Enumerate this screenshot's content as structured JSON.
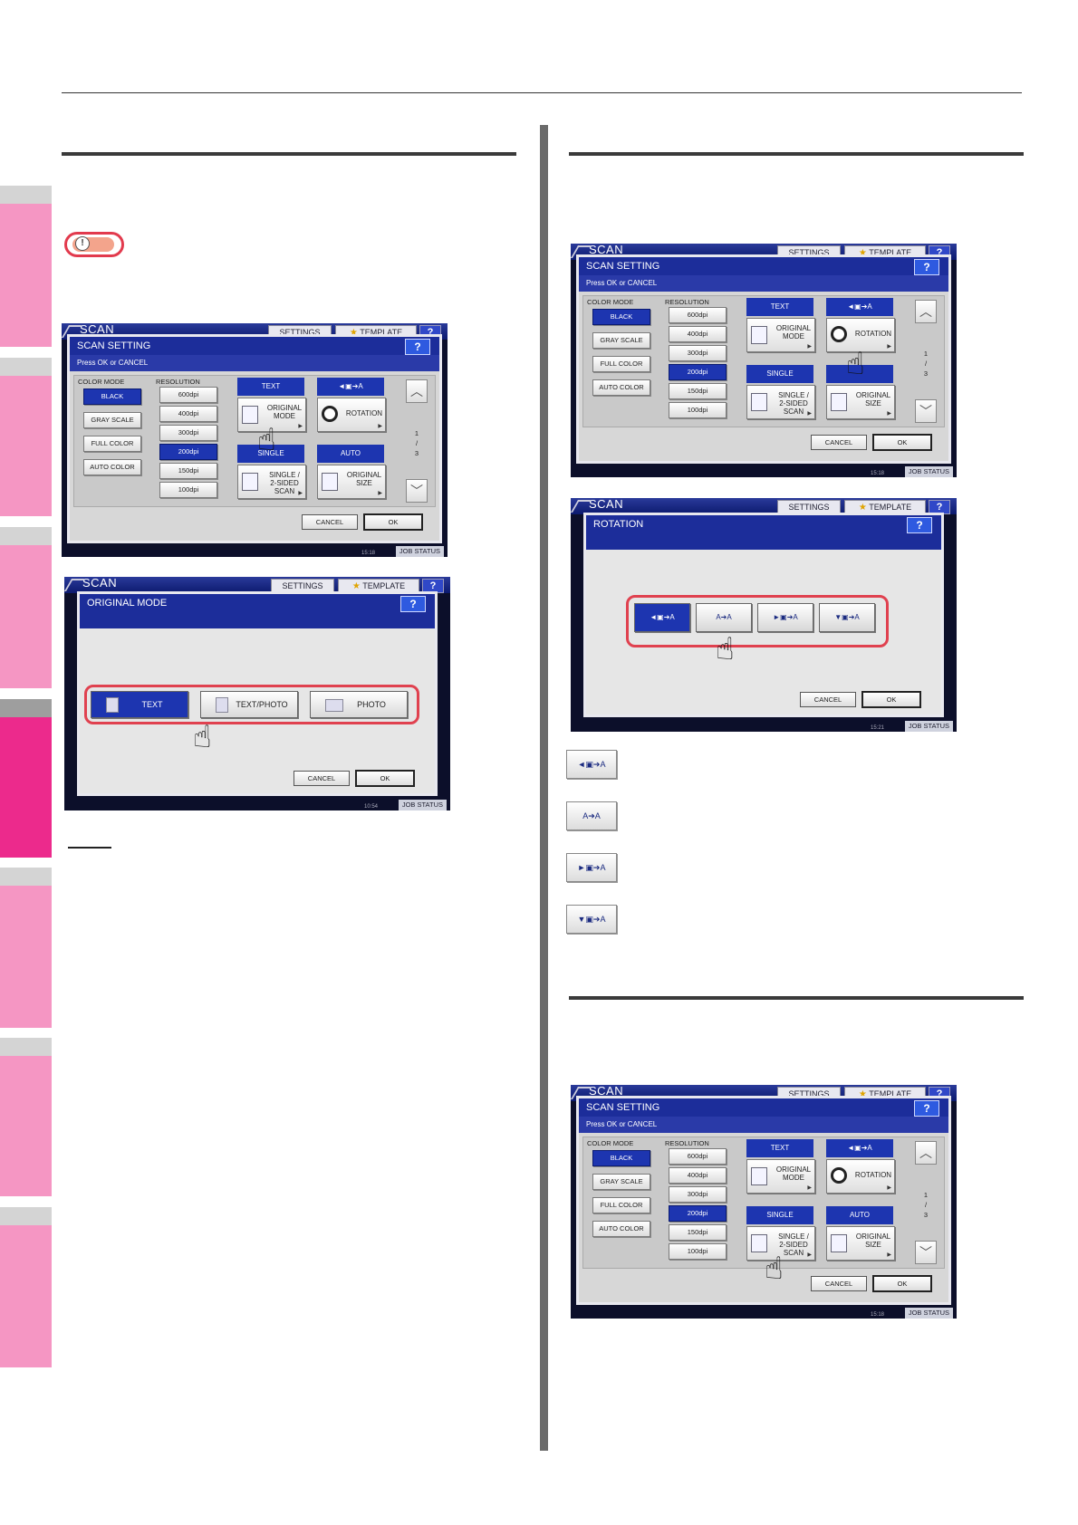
{
  "note_icon": "warning-note-icon",
  "shared": {
    "scan": "SCAN",
    "settings": "SETTINGS",
    "template": "TEMPLATE",
    "help": "?",
    "scan_setting": "SCAN SETTING",
    "press_ok": "Press OK or CANCEL",
    "color_mode": "COLOR MODE",
    "resolution": "RESOLUTION",
    "black": "BLACK",
    "gray": "GRAY SCALE",
    "full": "FULL COLOR",
    "auto_color": "AUTO COLOR",
    "r600": "600dpi",
    "r400": "400dpi",
    "r300": "300dpi",
    "r200": "200dpi",
    "r150": "150dpi",
    "r100": "100dpi",
    "text": "TEXT",
    "original_mode": "ORIGINAL MODE",
    "rotation": "ROTATION",
    "single": "SINGLE",
    "auto": "AUTO",
    "single_2sided": "SINGLE / 2-SIDED SCAN",
    "original_size": "ORIGINAL SIZE",
    "page_num": "1",
    "page_den": "3",
    "cancel": "CANCEL",
    "ok": "OK",
    "job_status": "JOB STATUS"
  },
  "screen1": {
    "clock": "15:18"
  },
  "screen_original": {
    "title": "ORIGINAL MODE",
    "text": "TEXT",
    "text_photo": "TEXT/PHOTO",
    "photo": "PHOTO",
    "clock": "10:54"
  },
  "screen3": {
    "clock": "15:18"
  },
  "screen_rotation": {
    "title": "ROTATION",
    "options": [
      "◄▣➔A",
      "A➔A",
      "►▣➔A",
      "▼▣➔A"
    ],
    "clock": "15:21"
  },
  "rotation_icons": [
    "◄▣➔A",
    "A➔A",
    "►▣➔A",
    "▼▣➔A"
  ],
  "screen5": {
    "clock": "15:18"
  }
}
